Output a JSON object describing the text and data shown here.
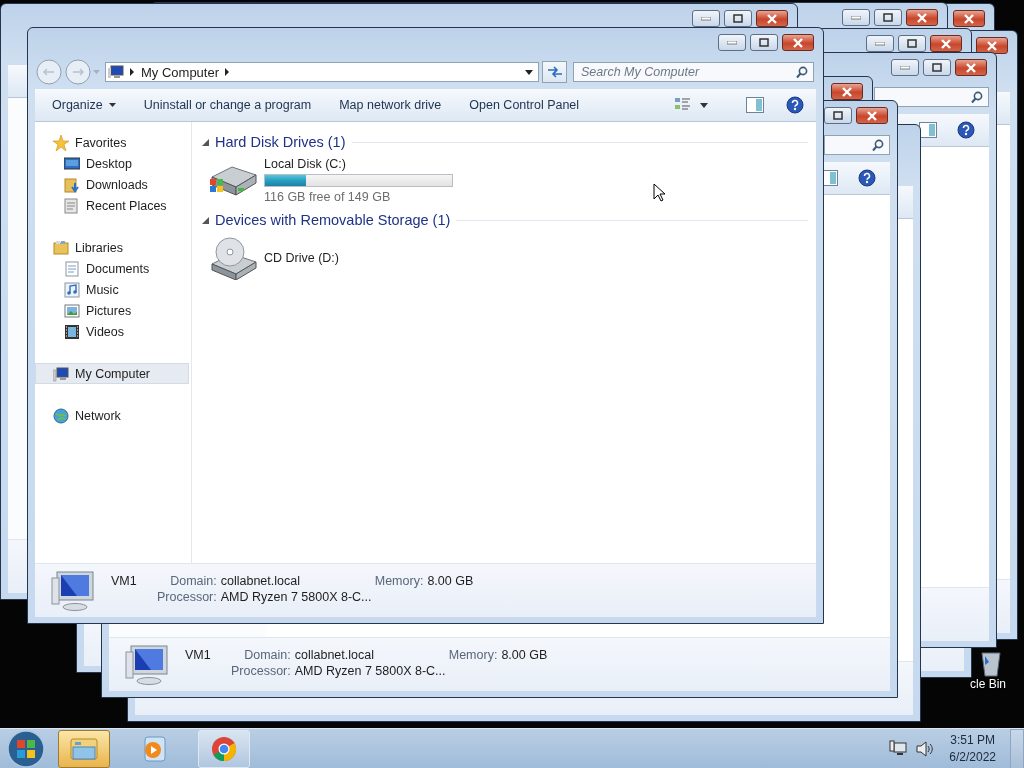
{
  "main_window": {
    "address": {
      "path": [
        "My Computer"
      ]
    },
    "search": {
      "placeholder": "Search My Computer"
    },
    "toolbar": [
      {
        "label": "Organize",
        "kind": "menu"
      },
      {
        "label": "Uninstall or change a program",
        "kind": "button"
      },
      {
        "label": "Map network drive",
        "kind": "button"
      },
      {
        "label": "Open Control Panel",
        "kind": "button"
      }
    ],
    "nav": [
      {
        "label": "Favorites",
        "kind": "favorites",
        "selected": false,
        "children": [
          {
            "label": "Desktop",
            "kind": "desktop",
            "selected": false
          },
          {
            "label": "Downloads",
            "kind": "downloads",
            "selected": false
          },
          {
            "label": "Recent Places",
            "kind": "recent",
            "selected": false
          }
        ]
      },
      {
        "label": "Libraries",
        "kind": "libraries",
        "selected": false,
        "children": [
          {
            "label": "Documents",
            "kind": "documents",
            "selected": false
          },
          {
            "label": "Music",
            "kind": "music",
            "selected": false
          },
          {
            "label": "Pictures",
            "kind": "pictures",
            "selected": false
          },
          {
            "label": "Videos",
            "kind": "videos",
            "selected": false
          }
        ]
      },
      {
        "label": "My Computer",
        "kind": "computer",
        "selected": true
      },
      {
        "label": "Network",
        "kind": "network",
        "selected": false
      }
    ],
    "groups": [
      {
        "title": "Hard Disk Drives (1)",
        "expanded": true,
        "items": [
          {
            "kind": "hdd",
            "name": "Local Disk (C:)",
            "level": 0.22,
            "caption": "116 GB free of 149 GB"
          }
        ]
      },
      {
        "title": "Devices with Removable Storage (1)",
        "expanded": true,
        "items": [
          {
            "kind": "cd",
            "name": "CD Drive (D:)"
          }
        ]
      }
    ],
    "details": {
      "name": "VM1",
      "fields": [
        {
          "label": "Domain:",
          "value": "collabnet.local"
        },
        {
          "label": "Memory:",
          "value": "8.00 GB"
        },
        {
          "label": "Processor:",
          "value": "AMD Ryzen 7 5800X 8-C..."
        }
      ]
    }
  },
  "back_window": {
    "details": {
      "name": "VM1",
      "fields": [
        {
          "label": "Domain:",
          "value": "collabnet.local"
        },
        {
          "label": "Memory:",
          "value": "8.00 GB"
        },
        {
          "label": "Processor:",
          "value": "AMD Ryzen 7 5800X 8-C..."
        }
      ]
    }
  },
  "desktop": {
    "recycle_bin_label": "cle Bin"
  },
  "taskbar": {
    "apps": [
      {
        "kind": "explorer",
        "selected": true,
        "running": true
      },
      {
        "kind": "media",
        "selected": false,
        "running": false
      },
      {
        "kind": "chrome",
        "selected": false,
        "running": true
      }
    ],
    "time": "3:51 PM",
    "date": "6/2/2022"
  }
}
